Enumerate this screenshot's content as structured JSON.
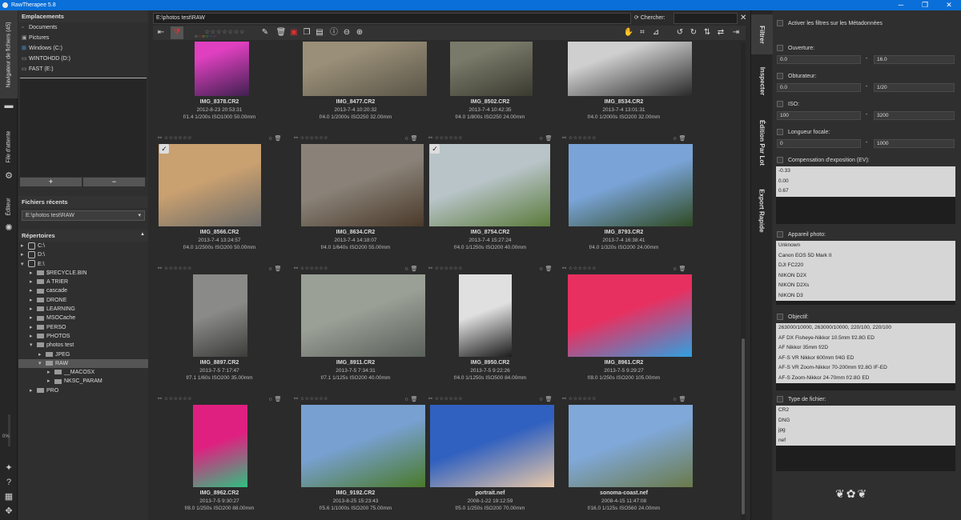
{
  "window": {
    "title": "RawTherapee 5.8",
    "minimize": "─",
    "maximize": "❐",
    "close": "✕"
  },
  "left_tabs": {
    "file_browser": "Navigateur de fichiers (45)",
    "queue": "File d'attente",
    "editor": "Éditeur",
    "progress": "0%"
  },
  "places": {
    "header": "Emplacements",
    "items": [
      "Documents",
      "Pictures",
      "Windows (C:)",
      "WINTOHDD (D:)",
      "FAST (E:)"
    ],
    "add": "+",
    "remove": "−"
  },
  "recent": {
    "header": "Fichiers récents",
    "value": "E:\\photos test\\RAW"
  },
  "dirs": {
    "header": "Répertoires",
    "items": [
      {
        "label": "C:\\",
        "type": "drive",
        "indent": 0,
        "arrow": "▸"
      },
      {
        "label": "D:\\",
        "type": "drive",
        "indent": 0,
        "arrow": "▸"
      },
      {
        "label": "E:\\",
        "type": "drive",
        "indent": 0,
        "arrow": "▾"
      },
      {
        "label": "$RECYCLE.BIN",
        "type": "folder",
        "indent": 1,
        "arrow": "▸"
      },
      {
        "label": "A TRIER",
        "type": "folder",
        "indent": 1,
        "arrow": "▸"
      },
      {
        "label": "cascade",
        "type": "folder",
        "indent": 1,
        "arrow": "▸"
      },
      {
        "label": "DRONE",
        "type": "folder",
        "indent": 1,
        "arrow": "▸"
      },
      {
        "label": "LEARNING",
        "type": "folder",
        "indent": 1,
        "arrow": "▸"
      },
      {
        "label": "MSOCache",
        "type": "folder",
        "indent": 1,
        "arrow": "▸"
      },
      {
        "label": "PERSO",
        "type": "folder",
        "indent": 1,
        "arrow": "▸"
      },
      {
        "label": "PHOTOS",
        "type": "folder",
        "indent": 1,
        "arrow": "▸"
      },
      {
        "label": "photos test",
        "type": "folder",
        "indent": 1,
        "arrow": "▾"
      },
      {
        "label": "JPEG",
        "type": "folder",
        "indent": 2,
        "arrow": "▸"
      },
      {
        "label": "RAW",
        "type": "folder",
        "indent": 2,
        "arrow": "▾",
        "selected": true
      },
      {
        "label": "__MACOSX",
        "type": "folder",
        "indent": 3,
        "arrow": "▸"
      },
      {
        "label": "NKSC_PARAM",
        "type": "folder",
        "indent": 3,
        "arrow": "▸"
      },
      {
        "label": "PRO",
        "type": "folder",
        "indent": 1,
        "arrow": "▸"
      }
    ]
  },
  "browser": {
    "path": "E:\\photos test\\RAW",
    "search_label": "Chercher:",
    "search_value": ""
  },
  "thumbs": [
    {
      "name": "IMG_8378.CR2",
      "date": "2012-8-23 20:53:31",
      "meta": "f/1.4 1/200s ISO1000 50.00mm",
      "checked": false,
      "colors": [
        "#e040c0",
        "#402050"
      ]
    },
    {
      "name": "IMG_8477.CR2",
      "date": "2013-7-4 10:20:32",
      "meta": "f/4.0 1/2000s ISO250 32.00mm",
      "checked": false,
      "colors": [
        "#9a8f78",
        "#5a5548"
      ]
    },
    {
      "name": "IMG_8502.CR2",
      "date": "2013-7-4 10:42:35",
      "meta": "f/4.0 1/800s ISO250 24.00mm",
      "checked": false,
      "colors": [
        "#7a7a6a",
        "#3a3a30"
      ]
    },
    {
      "name": "IMG_8534.CR2",
      "date": "2013-7-4 13:01:31",
      "meta": "f/4.0 1/2000s ISO200 32.00mm",
      "checked": false,
      "colors": [
        "#cfcfcf",
        "#2a2a2a"
      ]
    },
    {
      "name": "IMG_8566.CR2",
      "date": "2013-7-4 13:24:57",
      "meta": "f/4.0 1/2500s ISO200 50.00mm",
      "checked": true,
      "colors": [
        "#c9a070",
        "#6a6a68"
      ]
    },
    {
      "name": "IMG_8634.CR2",
      "date": "2013-7-4 14:18:07",
      "meta": "f/4.0 1/640s ISO200 55.00mm",
      "checked": false,
      "colors": [
        "#8a8278",
        "#4a3a2a"
      ]
    },
    {
      "name": "IMG_8754.CR2",
      "date": "2013-7-4 15:27:24",
      "meta": "f/4.0 1/1250s ISO200 40.00mm",
      "checked": true,
      "colors": [
        "#b8c4c8",
        "#5a7a3a"
      ]
    },
    {
      "name": "IMG_8793.CR2",
      "date": "2013-7-4 16:38:41",
      "meta": "f/4.0 1/320s ISO200 24.00mm",
      "checked": false,
      "colors": [
        "#7aa4d8",
        "#2f4a22"
      ]
    },
    {
      "name": "IMG_8897.CR2",
      "date": "2013-7-5 7:17:47",
      "meta": "f/7.1 1/60s ISO200 35.00mm",
      "checked": false,
      "colors": [
        "#8a8a88",
        "#3c3c3a"
      ]
    },
    {
      "name": "IMG_8911.CR2",
      "date": "2013-7-5 7:34:31",
      "meta": "f/7.1 1/125s ISO200 40.00mm",
      "checked": false,
      "colors": [
        "#9aa096",
        "#5a605a"
      ]
    },
    {
      "name": "IMG_8950.CR2",
      "date": "2013-7-5 9:22:26",
      "meta": "f/4.0 1/1250s ISO500 84.00mm",
      "checked": false,
      "colors": [
        "#e0e0e0",
        "#1c1c1c"
      ]
    },
    {
      "name": "IMG_8961.CR2",
      "date": "2013-7-5 9:29:27",
      "meta": "f/8.0 1/250s ISO200 105.00mm",
      "checked": false,
      "colors": [
        "#e83060",
        "#30a0e0"
      ]
    },
    {
      "name": "IMG_8962.CR2",
      "date": "2013-7-5 9:30:27",
      "meta": "f/8.0 1/250s ISO200 88.00mm",
      "checked": false,
      "colors": [
        "#e02080",
        "#30c080"
      ]
    },
    {
      "name": "IMG_9192.CR2",
      "date": "2013-8-25 15:23:43",
      "meta": "f/5.6 1/1000s ISO200 75.00mm",
      "checked": false,
      "colors": [
        "#78a0d0",
        "#4a7a2a"
      ]
    },
    {
      "name": "portrait.nef",
      "date": "2008-1-22 19:12:59",
      "meta": "f/5.0 1/250s ISO200 70.00mm",
      "checked": false,
      "colors": [
        "#3060c0",
        "#e8c8a8"
      ]
    },
    {
      "name": "sonoma-coast.nef",
      "date": "2008-4-15 11:47:08",
      "meta": "f/16.0 1/125s ISO560 24.00mm",
      "checked": false,
      "colors": [
        "#80a8d8",
        "#6a7a4a"
      ]
    }
  ],
  "right_tabs": [
    "Filtrer",
    "Inspecter",
    "Édition Par Lot",
    "Export Rapide"
  ],
  "filters": {
    "enable": "Activer les filtres sur les Métadonnées",
    "aperture": {
      "label": "Ouverture:",
      "from": "0.0",
      "to": "16.0"
    },
    "shutter": {
      "label": "Obturateur:",
      "from": "0.0",
      "to": "1/20"
    },
    "iso": {
      "label": "ISO:",
      "from": "100",
      "to": "3200"
    },
    "focal": {
      "label": "Longueur focale:",
      "from": "0",
      "to": "1000"
    },
    "exposure": {
      "label": "Compensation d'exposition (EV):",
      "items": [
        "-0.33",
        "0.00",
        "0.67"
      ]
    },
    "camera": {
      "label": "Appareil photo:",
      "items": [
        "Unknown",
        "Canon EOS 5D Mark II",
        "DJI FC220",
        "NIKON D2X",
        "NIKON D2Xs",
        "NIKON D3"
      ]
    },
    "lens": {
      "label": "Objectif:",
      "items": [
        "263000/10000, 263000/10000, 220/100, 220/100",
        "AF DX Fisheye-Nikkor 10.5mm f/2.8G ED",
        "AF Nikkor 35mm f/2D",
        "AF-S VR Nikkor 600mm f/4G ED",
        "AF-S VR Zoom-Nikkor 70-200mm f/2.8G IF-ED",
        "AF-S Zoom-Nikkor 24-70mm f/2.8G ED"
      ]
    },
    "filetype": {
      "label": "Type de fichier:",
      "items": [
        "CR2",
        "DNG",
        "jpg",
        "nef"
      ]
    },
    "dash": "-"
  }
}
